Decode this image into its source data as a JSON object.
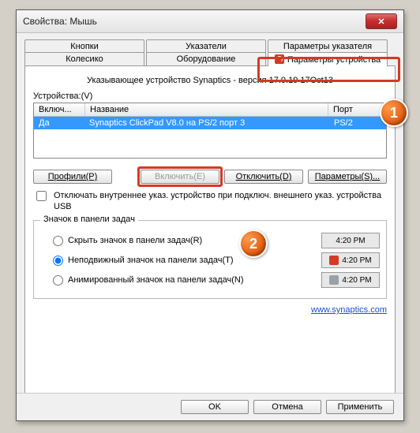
{
  "window": {
    "title": "Свойства: Мышь"
  },
  "tabs": {
    "row1": [
      "Кнопки",
      "Указатели",
      "Параметры указателя"
    ],
    "row2": [
      "Колесико",
      "Оборудование",
      "Параметры устройства"
    ],
    "active": "Параметры устройства"
  },
  "panel": {
    "header": "Указывающее устройство Synaptics - версия 17.0.19 17Oct13",
    "devices_label": "Устройства:(V)",
    "columns": {
      "enabled": "Включ...",
      "name": "Название",
      "port": "Порт"
    },
    "rows": [
      {
        "enabled": "Да",
        "name": "Synaptics ClickPad V8.0 на PS/2 порт 3",
        "port": "PS/2"
      }
    ],
    "buttons": {
      "profiles": "Профили(P)",
      "enable": "Включить(E)",
      "disable": "Отключить(D)",
      "settings": "Параметры(S)..."
    },
    "checkbox": "Отключать внутреннее указ. устройство при подключ. внешнего указ. устройства USB",
    "trayGroup": {
      "legend": "Значок в панели задач",
      "options": [
        "Скрыть значок в панели задач(R)",
        "Неподвижный значок на панели задач(T)",
        "Анимированный значок на панели задач(N)"
      ],
      "selected": 1,
      "time": "4:20 PM"
    },
    "link": "www.synaptics.com"
  },
  "footer": {
    "ok": "OK",
    "cancel": "Отмена",
    "apply": "Применить"
  },
  "callouts": {
    "one": "1",
    "two": "2"
  }
}
